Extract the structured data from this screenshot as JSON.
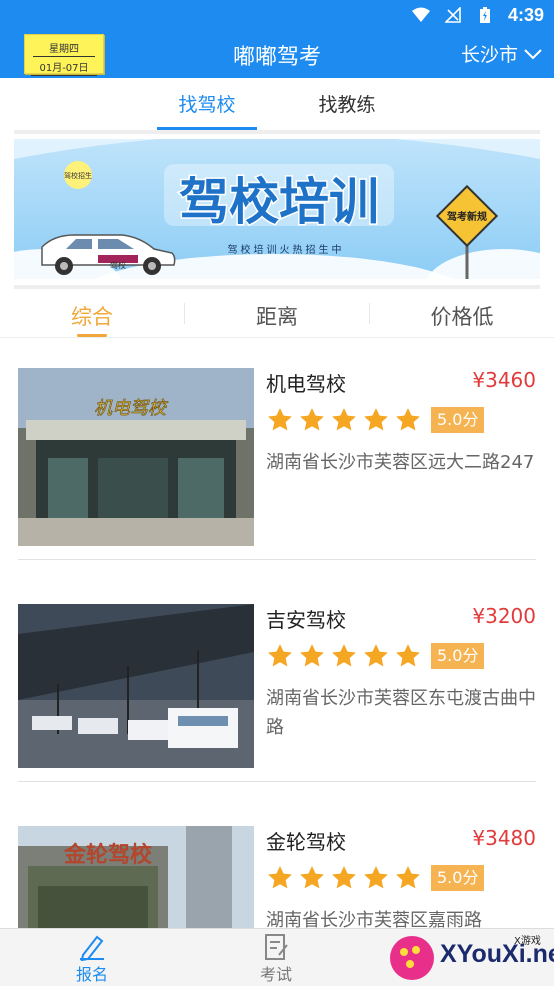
{
  "status_bar": {
    "time": "4:39"
  },
  "app_bar": {
    "title": "嘟嘟驾考",
    "date_note": {
      "weekday": "星期四",
      "date": "01月-07日"
    },
    "city": "长沙市"
  },
  "tabs": [
    {
      "label": "找驾校",
      "active": true
    },
    {
      "label": "找教练",
      "active": false
    }
  ],
  "banner": {
    "headline": "驾校培训",
    "subline": "驾校培训火热招生中",
    "tag": "驾校招生",
    "sign": "驾考新规",
    "car_label": "驾校"
  },
  "sort_options": [
    {
      "label": "综合",
      "active": true
    },
    {
      "label": "距离",
      "active": false
    },
    {
      "label": "价格低",
      "active": false
    }
  ],
  "schools": [
    {
      "name": "机电驾校",
      "price": "¥3460",
      "rating": 5,
      "score": "5.0分",
      "address": "湖南省长沙市芙蓉区远大二路247",
      "sign": "机电驾校"
    },
    {
      "name": "吉安驾校",
      "price": "¥3200",
      "rating": 5,
      "score": "5.0分",
      "address": "湖南省长沙市芙蓉区东屯渡古曲中路"
    },
    {
      "name": "金轮驾校",
      "price": "¥3480",
      "rating": 5,
      "score": "5.0分",
      "address": "湖南省长沙市芙蓉区嘉雨路",
      "sign": "金轮驾校"
    }
  ],
  "bottom_nav": [
    {
      "label": "报名",
      "active": true,
      "icon": "pen-icon"
    },
    {
      "label": "考试",
      "active": false,
      "icon": "exam-icon"
    }
  ],
  "watermark": {
    "text": "XYouXi.net",
    "small": "X游戏"
  },
  "colors": {
    "primary": "#1e8bf0",
    "accent": "#f0a83a",
    "price": "#e23b3b",
    "star": "#f5a623"
  }
}
